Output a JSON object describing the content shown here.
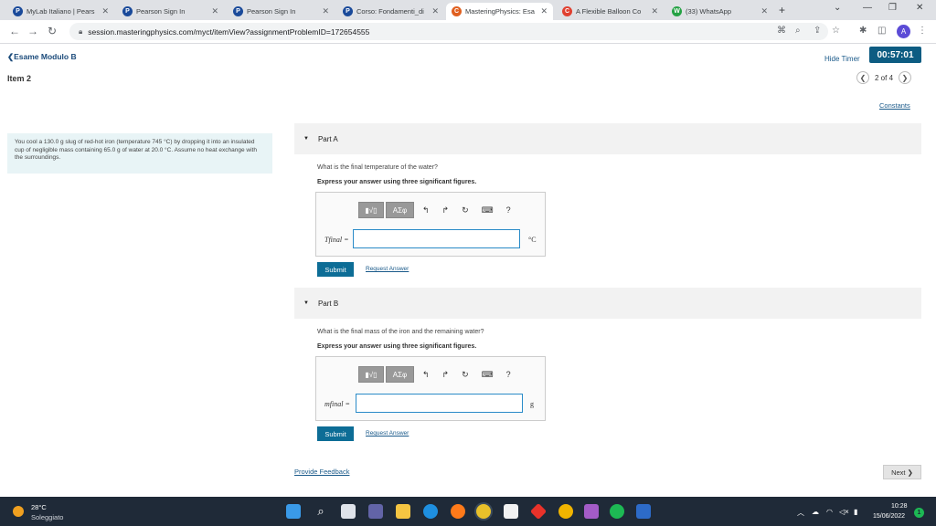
{
  "browser": {
    "tabs": [
      {
        "label": "MyLab Italiano | Pears",
        "fav": "P",
        "color": "#1a4a9a",
        "active": false
      },
      {
        "label": "Pearson Sign In",
        "fav": "P",
        "color": "#1a4a9a",
        "active": false
      },
      {
        "label": "Pearson Sign In",
        "fav": "P",
        "color": "#1a4a9a",
        "active": false
      },
      {
        "label": "Corso: Fondamenti_di",
        "fav": "P",
        "color": "#1a4a9a",
        "active": false
      },
      {
        "label": "MasteringPhysics: Esa",
        "fav": "C",
        "color": "#e06020",
        "active": true
      },
      {
        "label": "A Flexible Balloon Co",
        "fav": "C",
        "color": "#e04030",
        "active": false
      },
      {
        "label": "(33) WhatsApp",
        "fav": "W",
        "color": "#25a244",
        "active": false
      }
    ],
    "new_tab": "+",
    "url": "session.masteringphysics.com/myct/itemView?assignmentProblemID=172654555",
    "profile_initial": "A"
  },
  "page": {
    "back_link": "❮Esame Modulo B",
    "item_title": "Item 2",
    "hide_timer": "Hide Timer",
    "timer": "00:57:01",
    "pager": "2 of 4",
    "constants": "Constants",
    "problem_text": "You cool a 130.0 g slug of red-hot iron (temperature 745 °C) by dropping it into an insulated cup of negligible mass containing 65.0 g of water at 20.0 °C. Assume no heat exchange with the surroundings.",
    "part_a": {
      "title": "Part A",
      "question": "What is the final temperature of the water?",
      "instruction": "Express your answer using three significant figures.",
      "var_label": "Tfinal =",
      "unit": "°C",
      "submit": "Submit",
      "request": "Request Answer"
    },
    "part_b": {
      "title": "Part B",
      "question": "What is the final mass of the iron and the remaining water?",
      "instruction": "Express your answer using three significant figures.",
      "var_label": "mfinal =",
      "unit": "g",
      "submit": "Submit",
      "request": "Request Answer"
    },
    "toolbar": {
      "template_label": "▮√▯",
      "greek_label": "ΑΣφ",
      "undo": "↰",
      "redo": "↱",
      "reset": "↻",
      "keyboard": "⌨",
      "help": "?"
    },
    "feedback": "Provide Feedback",
    "next": "Next ❯"
  },
  "taskbar": {
    "temperature": "28°C",
    "weather": "Soleggiato",
    "time": "10:28",
    "date": "15/06/2022",
    "notifications": "1"
  }
}
